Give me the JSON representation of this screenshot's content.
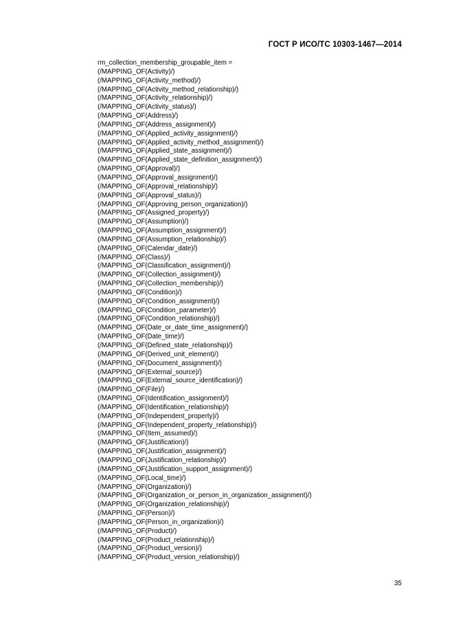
{
  "document": {
    "standard_header": "ГОСТ Р ИСО/ТС 10303-1467—2014",
    "page_number": "35",
    "definition_title": "rm_collection_membership_groupable_item =",
    "mapping_lines": [
      "(/MAPPING_OF(Activity)/)",
      "(/MAPPING_OF(Activity_method)/)",
      "(/MAPPING_OF(Activity_method_relationship)/)",
      "(/MAPPING_OF(Activity_relationship)/)",
      "(/MAPPING_OF(Activity_status)/)",
      "(/MAPPING_OF(Address)/)",
      "(/MAPPING_OF(Address_assignment)/)",
      "(/MAPPING_OF(Applied_activity_assignment)/)",
      "(/MAPPING_OF(Applied_activity_method_assignment)/)",
      "(/MAPPING_OF(Applied_state_assignment)/)",
      "(/MAPPING_OF(Applied_state_definition_assignment)/)",
      "(/MAPPING_OF(Approval)/)",
      "(/MAPPING_OF(Approval_assignment)/)",
      "(/MAPPING_OF(Approval_relationship)/)",
      "(/MAPPING_OF(Approval_status)/)",
      "(/MAPPING_OF(Approving_person_organization)/)",
      "(/MAPPING_OF(Assigned_property)/)",
      "(/MAPPING_OF(Assumption)/)",
      "(/MAPPING_OF(Assumption_assignment)/)",
      "(/MAPPING_OF(Assumption_relationship)/)",
      "(/MAPPING_OF(Calendar_date)/)",
      "(/MAPPING_OF(Class)/)",
      "(/MAPPING_OF(Classification_assignment)/)",
      "(/MAPPING_OF(Collection_assignment)/)",
      "(/MAPPING_OF(Collection_membership)/)",
      "(/MAPPING_OF(Condition)/)",
      "(/MAPPING_OF(Condition_assignment)/)",
      "(/MAPPING_OF(Condition_parameter)/)",
      "(/MAPPING_OF(Condition_relationship)/)",
      "(/MAPPING_OF(Date_or_date_time_assignment)/)",
      "(/MAPPING_OF(Date_time)/)",
      "(/MAPPING_OF(Defined_state_relationship)/)",
      "(/MAPPING_OF(Derived_unit_element)/)",
      "(/MAPPING_OF(Document_assignment)/)",
      "(/MAPPING_OF(External_source)/)",
      "(/MAPPING_OF(External_source_identification)/)",
      "(/MAPPING_OF(File)/)",
      "(/MAPPING_OF(Identification_assignment)/)",
      "(/MAPPING_OF(Identification_relationship)/)",
      "(/MAPPING_OF(Independent_property)/)",
      "(/MAPPING_OF(Independent_property_relationship)/)",
      "(/MAPPING_OF(Item_assumed)/)",
      "(/MAPPING_OF(Justification)/)",
      "(/MAPPING_OF(Justification_assignment)/)",
      "(/MAPPING_OF(Justification_relationship)/)",
      "(/MAPPING_OF(Justification_support_assignment)/)",
      "(/MAPPING_OF(Local_time)/)",
      "(/MAPPING_OF(Organization)/)",
      "(/MAPPING_OF(Organization_or_person_in_organization_assignment)/)",
      "(/MAPPING_OF(Organization_relationship)/)",
      "(/MAPPING_OF(Person)/)",
      "(/MAPPING_OF(Person_in_organization)/)",
      "(/MAPPING_OF(Product)/)",
      "(/MAPPING_OF(Product_relationship)/)",
      "(/MAPPING_OF(Product_version)/)",
      "(/MAPPING_OF(Product_version_relationship)/)"
    ]
  }
}
